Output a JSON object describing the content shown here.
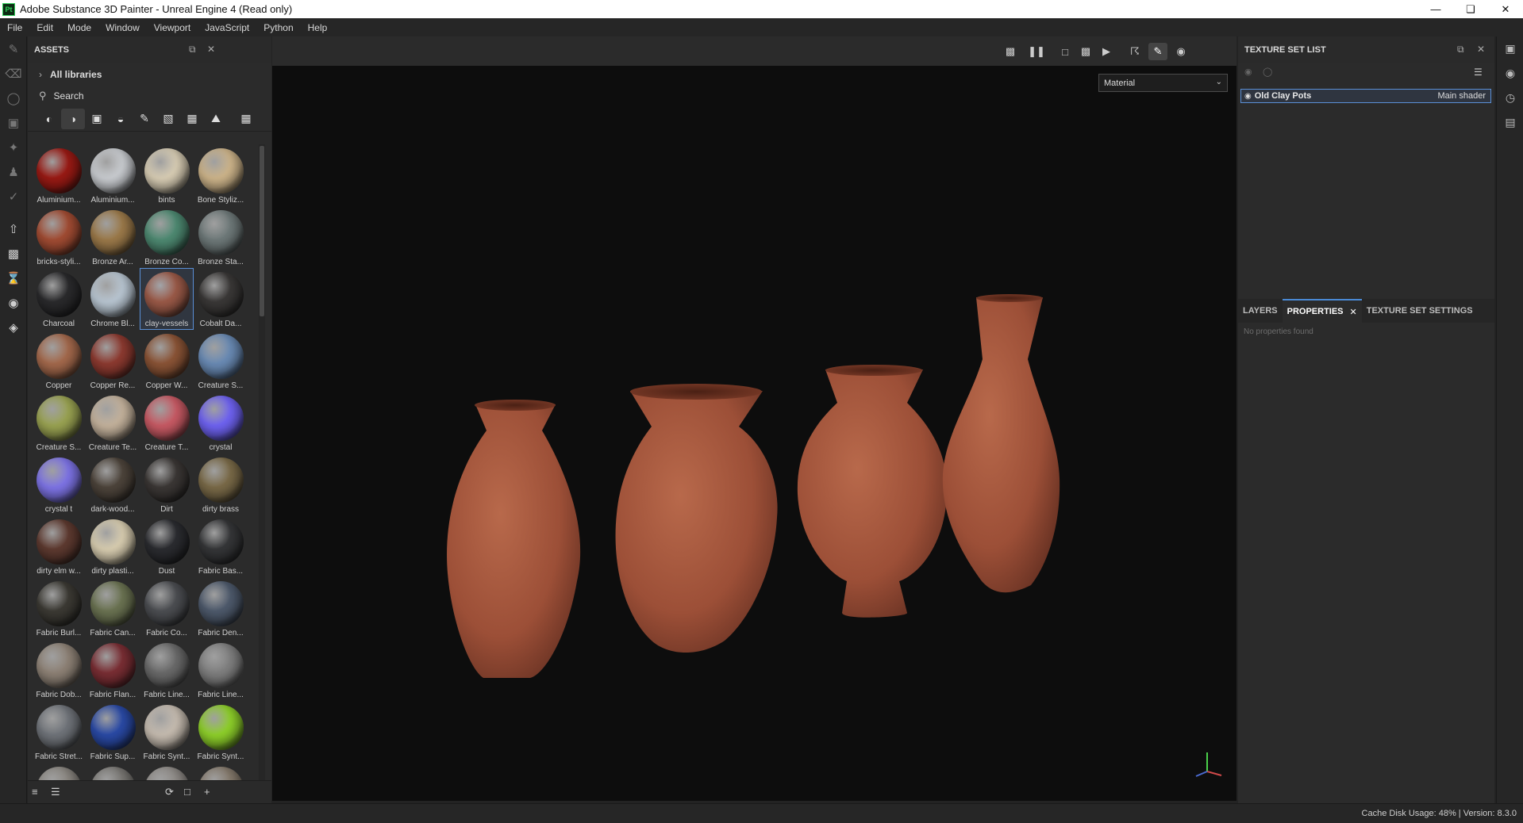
{
  "window": {
    "title": "Adobe Substance 3D Painter - Unreal Engine 4 (Read only)",
    "app_badge": "Pt"
  },
  "menu": [
    "File",
    "Edit",
    "Mode",
    "Window",
    "Viewport",
    "JavaScript",
    "Python",
    "Help"
  ],
  "assets": {
    "title": "ASSETS",
    "library": "All libraries",
    "search_placeholder": "Search",
    "items": [
      {
        "label": "Aluminium...",
        "color": "#9a1a14"
      },
      {
        "label": "Aluminium...",
        "color": "#c9ccd0"
      },
      {
        "label": "bints",
        "color": "#d8cdb4"
      },
      {
        "label": "Bone Styliz...",
        "color": "#cdb48a"
      },
      {
        "label": "bricks-styli...",
        "color": "#a24c33"
      },
      {
        "label": "Bronze Ar...",
        "color": "#9c7a4a"
      },
      {
        "label": "Bronze Co...",
        "color": "#4e8a72"
      },
      {
        "label": "Bronze Sta...",
        "color": "#6f7a7a"
      },
      {
        "label": "Charcoal",
        "color": "#2a2a2c"
      },
      {
        "label": "Chrome Bl...",
        "color": "#b9c6d2"
      },
      {
        "label": "clay-vessels",
        "color": "#9b5a48"
      },
      {
        "label": "Cobalt Da...",
        "color": "#3a3837"
      },
      {
        "label": "Copper",
        "color": "#a4694c"
      },
      {
        "label": "Copper Re...",
        "color": "#8d3a30"
      },
      {
        "label": "Copper W...",
        "color": "#8b5436"
      },
      {
        "label": "Creature S...",
        "color": "#6a8bb5"
      },
      {
        "label": "Creature S...",
        "color": "#9aa352"
      },
      {
        "label": "Creature Te...",
        "color": "#c4b29c"
      },
      {
        "label": "Creature T...",
        "color": "#c85a64"
      },
      {
        "label": "crystal",
        "color": "#6f63f2"
      },
      {
        "label": "crystal t",
        "color": "#7e74e6"
      },
      {
        "label": "dark-wood...",
        "color": "#4d443b"
      },
      {
        "label": "Dirt",
        "color": "#3b3735"
      },
      {
        "label": "dirty brass",
        "color": "#7a6a48"
      },
      {
        "label": "dirty elm w...",
        "color": "#5e3a30"
      },
      {
        "label": "dirty plasti...",
        "color": "#d8cdb0"
      },
      {
        "label": "Dust",
        "color": "#2b2c30"
      },
      {
        "label": "Fabric Bas...",
        "color": "#353638"
      },
      {
        "label": "Fabric Burl...",
        "color": "#3c3a34"
      },
      {
        "label": "Fabric Can...",
        "color": "#6b7352"
      },
      {
        "label": "Fabric Co...",
        "color": "#4c4e52"
      },
      {
        "label": "Fabric Den...",
        "color": "#4e5a6c"
      },
      {
        "label": "Fabric Dob...",
        "color": "#8e8276"
      },
      {
        "label": "Fabric Flan...",
        "color": "#7a2e34"
      },
      {
        "label": "Fabric Line...",
        "color": "#6a6a6a"
      },
      {
        "label": "Fabric Line...",
        "color": "#808080"
      },
      {
        "label": "Fabric Stret...",
        "color": "#70747a"
      },
      {
        "label": "Fabric Sup...",
        "color": "#2a4aa6"
      },
      {
        "label": "Fabric Synt...",
        "color": "#c6bcb0"
      },
      {
        "label": "Fabric Synt...",
        "color": "#8ed02a"
      },
      {
        "label": "",
        "color": "#8a8680"
      },
      {
        "label": "",
        "color": "#7a7874"
      },
      {
        "label": "",
        "color": "#8e8a86"
      },
      {
        "label": "",
        "color": "#857a6c"
      }
    ]
  },
  "viewport": {
    "material_mode": "Material"
  },
  "texture_set_list": {
    "title": "TEXTURE SET LIST",
    "set_name": "Old Clay Pots",
    "shader": "Main shader"
  },
  "bottom_panel": {
    "tabs": [
      "LAYERS",
      "PROPERTIES",
      "TEXTURE SET SETTINGS"
    ],
    "active_tab": "PROPERTIES",
    "empty_text": "No properties found"
  },
  "status": {
    "text": "Cache Disk Usage:   48% | Version: 8.3.0"
  },
  "colors": {
    "clay": "#a55a40",
    "selection": "#5a8fd6",
    "accent_tab": "#4a8ad6"
  }
}
